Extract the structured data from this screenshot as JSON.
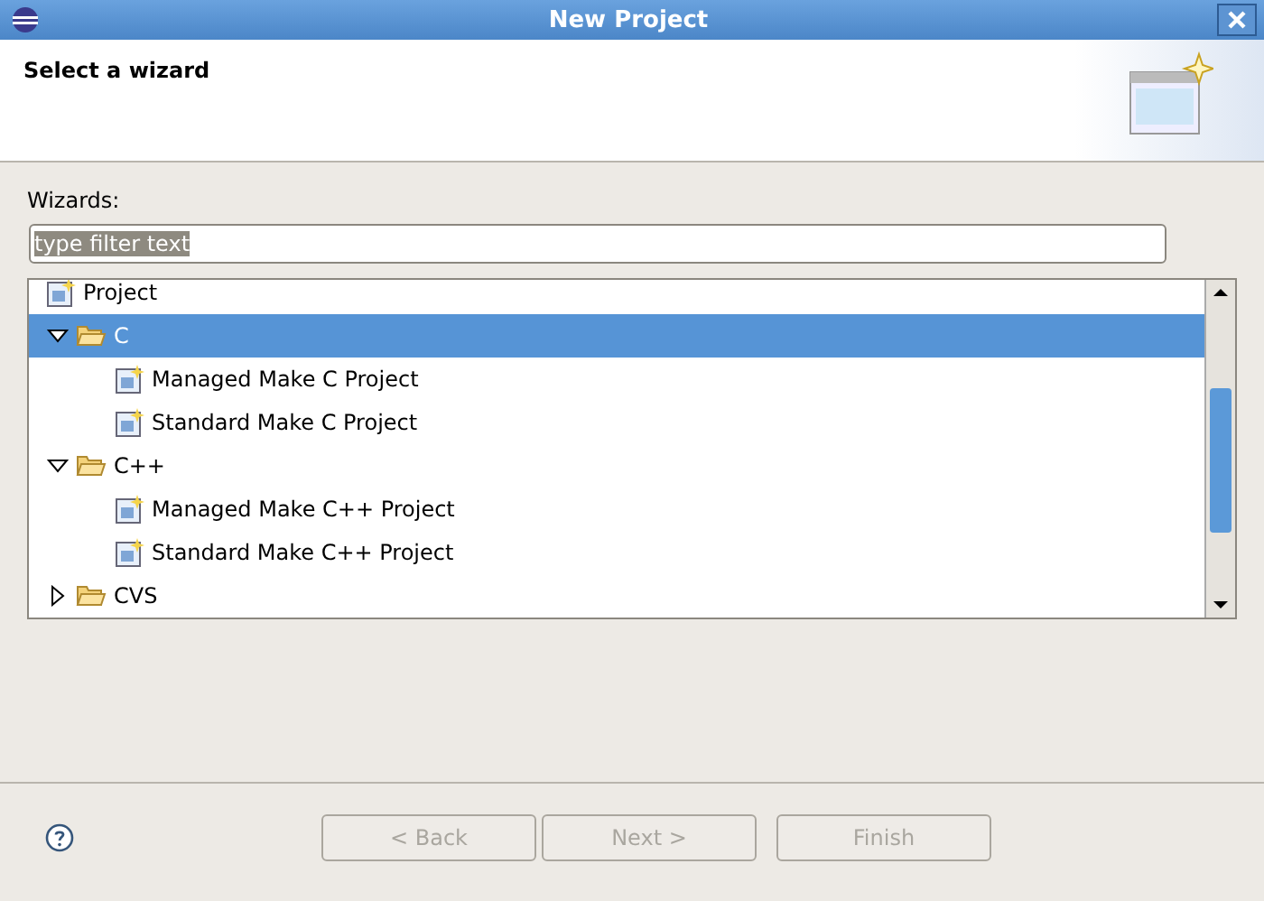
{
  "window": {
    "title": "New Project"
  },
  "header": {
    "title": "Select a wizard"
  },
  "filter": {
    "label": "Wizards:",
    "value": "type filter text"
  },
  "tree": [
    {
      "label": "Project",
      "kind": "project",
      "selected": false
    },
    {
      "label": "C",
      "kind": "folder",
      "expanded": true,
      "selected": true,
      "children": [
        {
          "label": "Managed Make C Project",
          "kind": "project",
          "selected": false
        },
        {
          "label": "Standard Make C Project",
          "kind": "project",
          "selected": false
        }
      ]
    },
    {
      "label": "C++",
      "kind": "folder",
      "expanded": true,
      "selected": false,
      "children": [
        {
          "label": "Managed Make C++ Project",
          "kind": "project",
          "selected": false
        },
        {
          "label": "Standard Make C++ Project",
          "kind": "project",
          "selected": false
        }
      ]
    },
    {
      "label": "CVS",
      "kind": "folder",
      "expanded": false,
      "selected": false
    }
  ],
  "buttons": [
    {
      "label": "< Back",
      "disabled": true
    },
    {
      "label": "Next >",
      "disabled": true
    },
    {
      "label": "Finish",
      "disabled": true
    }
  ]
}
